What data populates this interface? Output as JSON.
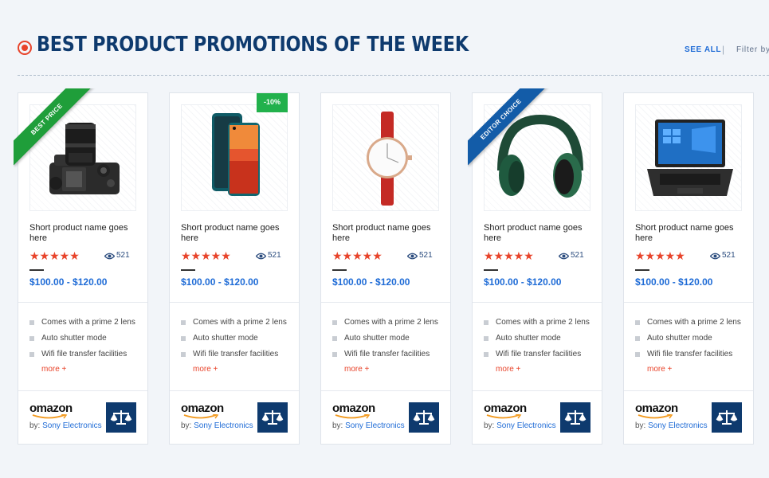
{
  "header": {
    "title": "BEST PRODUCT PROMOTIONS OF THE WEEK",
    "see_all": "SEE ALL",
    "separator": "|",
    "filter_by": "Filter by"
  },
  "colors": {
    "accent": "#e8432a",
    "title": "#0e3a6e",
    "link": "#1e6bd6",
    "badge_green": "#22b14c",
    "ribbon_blue": "#135ca8"
  },
  "products": [
    {
      "name": "Short product name goes here",
      "image_icon": "camera-icon",
      "badge": "BEST PRICE",
      "stars": "★★★★★",
      "rating": 5,
      "views": "521",
      "price": "$100.00 - $120.00",
      "features": [
        "Comes with a prime 2 lens",
        "Auto shutter mode",
        "Wifi file transfer facilities"
      ],
      "more": "more +",
      "brand": "omazon",
      "by_label": "by:",
      "seller": "Sony Electronics"
    },
    {
      "name": "Short product name goes here",
      "image_icon": "smartphone-icon",
      "discount": "-10%",
      "stars": "★★★★★",
      "rating": 5,
      "views": "521",
      "price": "$100.00 - $120.00",
      "features": [
        "Comes with a prime 2 lens",
        "Auto shutter mode",
        "Wifi file transfer facilities"
      ],
      "more": "more +",
      "brand": "omazon",
      "by_label": "by:",
      "seller": "Sony Electronics"
    },
    {
      "name": "Short product name goes here",
      "image_icon": "watch-icon",
      "stars": "★★★★★",
      "rating": 5,
      "views": "521",
      "price": "$100.00 - $120.00",
      "features": [
        "Comes with a prime 2 lens",
        "Auto shutter mode",
        "Wifi file transfer facilities"
      ],
      "more": "more +",
      "brand": "omazon",
      "by_label": "by:",
      "seller": "Sony Electronics"
    },
    {
      "name": "Short product name goes here",
      "image_icon": "headphones-icon",
      "badge": "EDITOR CHOICE",
      "stars": "★★★★★",
      "rating": 5,
      "views": "521",
      "price": "$100.00 - $120.00",
      "features": [
        "Comes with a prime 2 lens",
        "Auto shutter mode",
        "Wifi file transfer facilities"
      ],
      "more": "more +",
      "brand": "omazon",
      "by_label": "by:",
      "seller": "Sony Electronics"
    },
    {
      "name": "Short product name goes here",
      "image_icon": "laptop-icon",
      "stars": "★★★★★",
      "rating": 5,
      "views": "521",
      "price": "$100.00 - $120.00",
      "features": [
        "Comes with a prime 2 lens",
        "Auto shutter mode",
        "Wifi file transfer facilities"
      ],
      "more": "more +",
      "brand": "omazon",
      "by_label": "by:",
      "seller": "Sony Electronics"
    }
  ]
}
